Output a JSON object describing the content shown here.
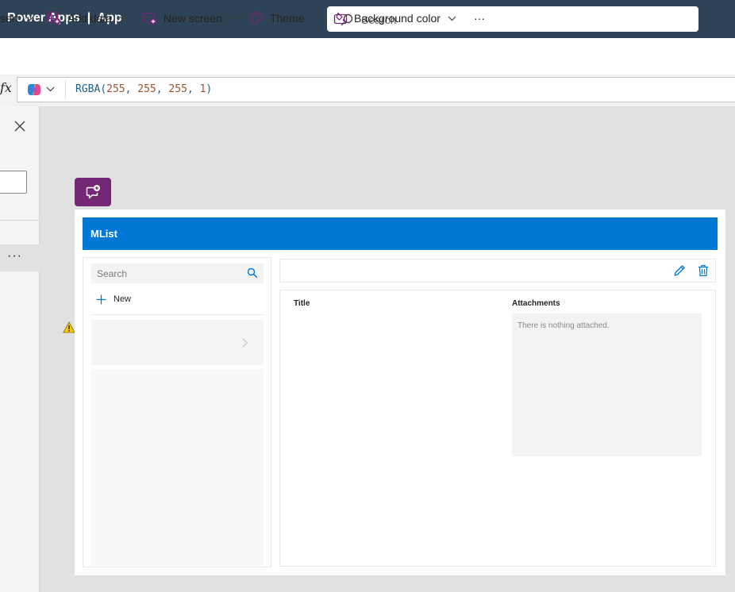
{
  "header": {
    "app_title": "Power Apps  |  App",
    "search_placeholder": "Search"
  },
  "commandbar": {
    "insert_label": "sert",
    "add_data_label": "Add data",
    "new_screen_label": "New screen",
    "theme_label": "Theme",
    "background_color_label": "Background color",
    "more_label": "···"
  },
  "formula_bar": {
    "fx_label": "fx",
    "func": "RGBA",
    "args": [
      "255",
      "255",
      "255",
      "1"
    ]
  },
  "left_pane": {
    "more_label": "···"
  },
  "app_screen": {
    "title": "MList",
    "search_placeholder": "Search",
    "new_label": "New",
    "title_field_label": "Title",
    "attachments_label": "Attachments",
    "attachments_empty_text": "There is nothing attached."
  },
  "colors": {
    "topbar": "#2f4356",
    "titlebar": "#0078d4",
    "chat_button": "#742774",
    "warning": "#f2c811"
  }
}
